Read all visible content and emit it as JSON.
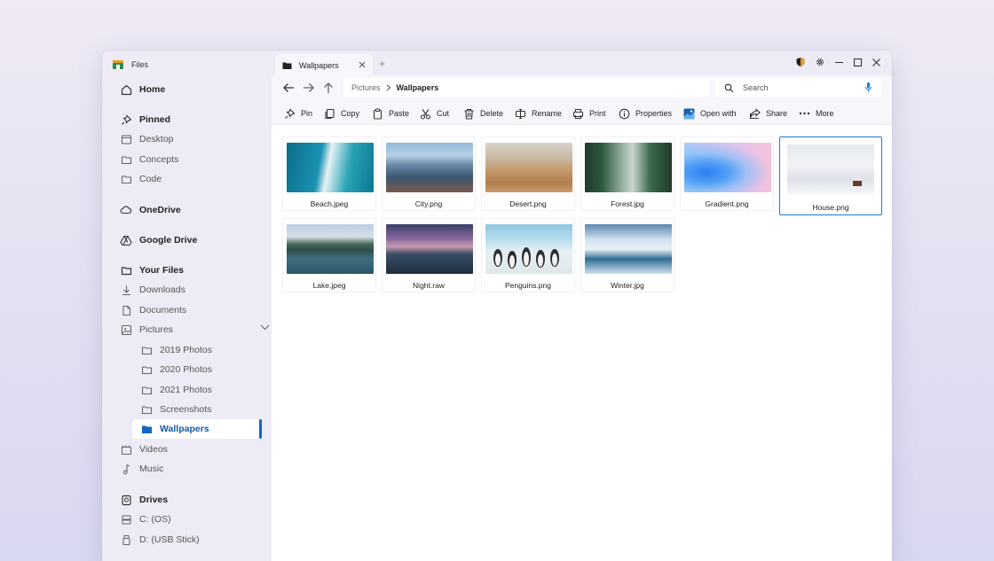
{
  "app": {
    "title": "Files"
  },
  "sidebar": {
    "home": "Home",
    "pinned": "Pinned",
    "pinned_items": [
      "Desktop",
      "Concepts",
      "Code"
    ],
    "onedrive": "OneDrive",
    "google_drive": "Google Drive",
    "your_files": "Your Files",
    "your_files_items": [
      "Downloads",
      "Documents",
      "Pictures"
    ],
    "pictures_items": [
      "2019 Photos",
      "2020 Photos",
      "2021 Photos",
      "Screenshots",
      "Wallpapers"
    ],
    "more_items": [
      "Videos",
      "Music"
    ],
    "drives": "Drives",
    "drive_items": [
      "C: (OS)",
      "D: (USB Stick)"
    ]
  },
  "tab": {
    "label": "Wallpapers",
    "new_tab": "+"
  },
  "address": {
    "crumbs": [
      "Pictures",
      "Wallpapers"
    ],
    "search_placeholder": "Search"
  },
  "toolbar": {
    "pin": "Pin",
    "copy": "Copy",
    "paste": "Paste",
    "cut": "Cut",
    "delete": "Delete",
    "rename": "Rename",
    "print": "Print",
    "properties": "Properties",
    "open_with": "Open with",
    "share": "Share",
    "more": "More"
  },
  "files": [
    "Beach.jpeg",
    "City.png",
    "Desert.png",
    "Forest.jpg",
    "Gradient.png",
    "House.png",
    "Lake.jpeg",
    "Night.raw",
    "Penguins.png",
    "Winter.jpg"
  ],
  "colors": {
    "accent": "#1268c4",
    "selection_border": "#1b7ad1"
  }
}
